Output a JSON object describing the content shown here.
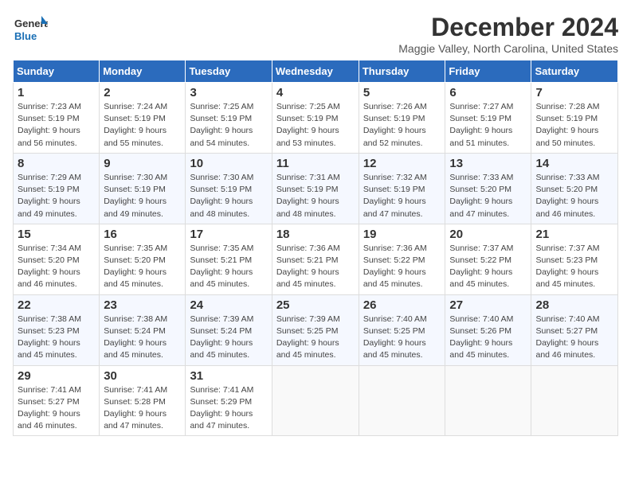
{
  "logo": {
    "general": "General",
    "blue": "Blue"
  },
  "header": {
    "title": "December 2024",
    "subtitle": "Maggie Valley, North Carolina, United States"
  },
  "weekdays": [
    "Sunday",
    "Monday",
    "Tuesday",
    "Wednesday",
    "Thursday",
    "Friday",
    "Saturday"
  ],
  "weeks": [
    [
      {
        "day": "1",
        "info": "Sunrise: 7:23 AM\nSunset: 5:19 PM\nDaylight: 9 hours\nand 56 minutes."
      },
      {
        "day": "2",
        "info": "Sunrise: 7:24 AM\nSunset: 5:19 PM\nDaylight: 9 hours\nand 55 minutes."
      },
      {
        "day": "3",
        "info": "Sunrise: 7:25 AM\nSunset: 5:19 PM\nDaylight: 9 hours\nand 54 minutes."
      },
      {
        "day": "4",
        "info": "Sunrise: 7:25 AM\nSunset: 5:19 PM\nDaylight: 9 hours\nand 53 minutes."
      },
      {
        "day": "5",
        "info": "Sunrise: 7:26 AM\nSunset: 5:19 PM\nDaylight: 9 hours\nand 52 minutes."
      },
      {
        "day": "6",
        "info": "Sunrise: 7:27 AM\nSunset: 5:19 PM\nDaylight: 9 hours\nand 51 minutes."
      },
      {
        "day": "7",
        "info": "Sunrise: 7:28 AM\nSunset: 5:19 PM\nDaylight: 9 hours\nand 50 minutes."
      }
    ],
    [
      {
        "day": "8",
        "info": "Sunrise: 7:29 AM\nSunset: 5:19 PM\nDaylight: 9 hours\nand 49 minutes."
      },
      {
        "day": "9",
        "info": "Sunrise: 7:30 AM\nSunset: 5:19 PM\nDaylight: 9 hours\nand 49 minutes."
      },
      {
        "day": "10",
        "info": "Sunrise: 7:30 AM\nSunset: 5:19 PM\nDaylight: 9 hours\nand 48 minutes."
      },
      {
        "day": "11",
        "info": "Sunrise: 7:31 AM\nSunset: 5:19 PM\nDaylight: 9 hours\nand 48 minutes."
      },
      {
        "day": "12",
        "info": "Sunrise: 7:32 AM\nSunset: 5:19 PM\nDaylight: 9 hours\nand 47 minutes."
      },
      {
        "day": "13",
        "info": "Sunrise: 7:33 AM\nSunset: 5:20 PM\nDaylight: 9 hours\nand 47 minutes."
      },
      {
        "day": "14",
        "info": "Sunrise: 7:33 AM\nSunset: 5:20 PM\nDaylight: 9 hours\nand 46 minutes."
      }
    ],
    [
      {
        "day": "15",
        "info": "Sunrise: 7:34 AM\nSunset: 5:20 PM\nDaylight: 9 hours\nand 46 minutes."
      },
      {
        "day": "16",
        "info": "Sunrise: 7:35 AM\nSunset: 5:20 PM\nDaylight: 9 hours\nand 45 minutes."
      },
      {
        "day": "17",
        "info": "Sunrise: 7:35 AM\nSunset: 5:21 PM\nDaylight: 9 hours\nand 45 minutes."
      },
      {
        "day": "18",
        "info": "Sunrise: 7:36 AM\nSunset: 5:21 PM\nDaylight: 9 hours\nand 45 minutes."
      },
      {
        "day": "19",
        "info": "Sunrise: 7:36 AM\nSunset: 5:22 PM\nDaylight: 9 hours\nand 45 minutes."
      },
      {
        "day": "20",
        "info": "Sunrise: 7:37 AM\nSunset: 5:22 PM\nDaylight: 9 hours\nand 45 minutes."
      },
      {
        "day": "21",
        "info": "Sunrise: 7:37 AM\nSunset: 5:23 PM\nDaylight: 9 hours\nand 45 minutes."
      }
    ],
    [
      {
        "day": "22",
        "info": "Sunrise: 7:38 AM\nSunset: 5:23 PM\nDaylight: 9 hours\nand 45 minutes."
      },
      {
        "day": "23",
        "info": "Sunrise: 7:38 AM\nSunset: 5:24 PM\nDaylight: 9 hours\nand 45 minutes."
      },
      {
        "day": "24",
        "info": "Sunrise: 7:39 AM\nSunset: 5:24 PM\nDaylight: 9 hours\nand 45 minutes."
      },
      {
        "day": "25",
        "info": "Sunrise: 7:39 AM\nSunset: 5:25 PM\nDaylight: 9 hours\nand 45 minutes."
      },
      {
        "day": "26",
        "info": "Sunrise: 7:40 AM\nSunset: 5:25 PM\nDaylight: 9 hours\nand 45 minutes."
      },
      {
        "day": "27",
        "info": "Sunrise: 7:40 AM\nSunset: 5:26 PM\nDaylight: 9 hours\nand 45 minutes."
      },
      {
        "day": "28",
        "info": "Sunrise: 7:40 AM\nSunset: 5:27 PM\nDaylight: 9 hours\nand 46 minutes."
      }
    ],
    [
      {
        "day": "29",
        "info": "Sunrise: 7:41 AM\nSunset: 5:27 PM\nDaylight: 9 hours\nand 46 minutes."
      },
      {
        "day": "30",
        "info": "Sunrise: 7:41 AM\nSunset: 5:28 PM\nDaylight: 9 hours\nand 47 minutes."
      },
      {
        "day": "31",
        "info": "Sunrise: 7:41 AM\nSunset: 5:29 PM\nDaylight: 9 hours\nand 47 minutes."
      },
      null,
      null,
      null,
      null
    ]
  ]
}
